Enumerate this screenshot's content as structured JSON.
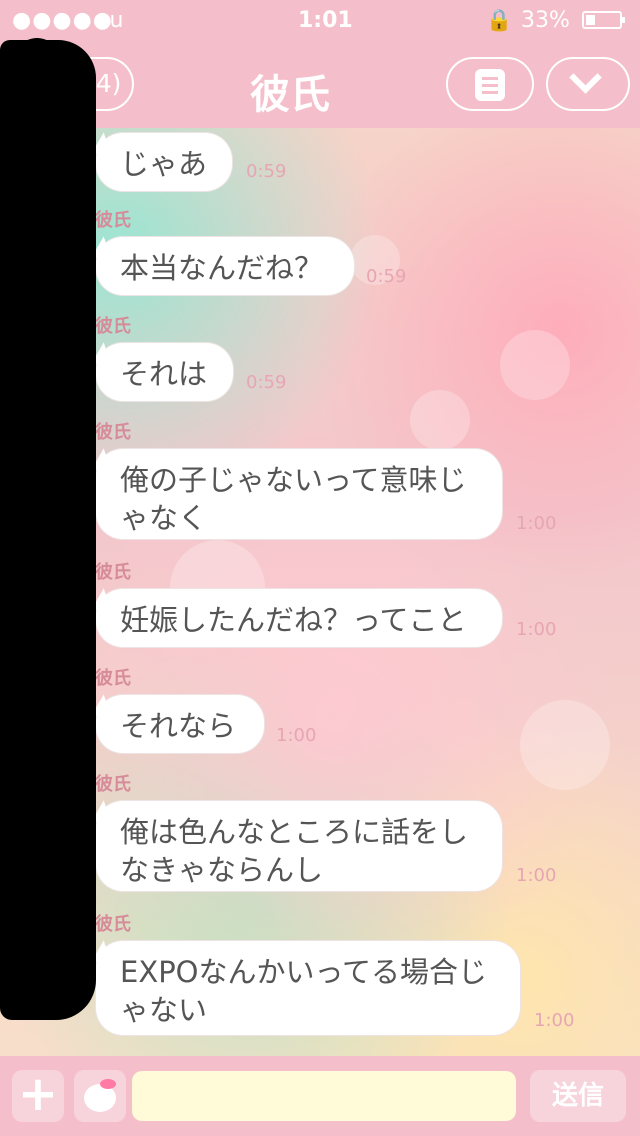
{
  "status_bar": {
    "signal": "●●●●●",
    "carrier": "au",
    "time": "1:01",
    "lock_icon": "rotation-lock-icon",
    "battery": "33%"
  },
  "header": {
    "back_label": "(4)",
    "back_icon": "back-arrow-icon",
    "title": "彼氏",
    "menu_icon": "menu-list-icon",
    "down_icon": "chevron-down-icon"
  },
  "messages": [
    {
      "sender": "",
      "text": "じゃあ",
      "time": "0:59"
    },
    {
      "sender": "彼氏",
      "text": "本当なんだね？",
      "time": "0:59"
    },
    {
      "sender": "彼氏",
      "text": "それは",
      "time": "0:59"
    },
    {
      "sender": "彼氏",
      "text": "俺の子じゃないって意味じゃなく",
      "time": "1:00"
    },
    {
      "sender": "彼氏",
      "text": "妊娠したんだね？ってこと",
      "time": "1:00"
    },
    {
      "sender": "彼氏",
      "text": "それなら",
      "time": "1:00"
    },
    {
      "sender": "彼氏",
      "text": "俺は色んなところに話をしなきゃならんし",
      "time": "1:00"
    },
    {
      "sender": "彼氏",
      "text": "EXPOなんかいってる場合じゃない",
      "time": "1:00"
    }
  ],
  "input_bar": {
    "plus_label": "+",
    "sticker_icon": "sticker-icon",
    "input_value": "",
    "send_label": "送信"
  },
  "colors": {
    "header": "#f4bfca",
    "bubble": "#ffffff",
    "timestamp": "#e6a6b4"
  }
}
